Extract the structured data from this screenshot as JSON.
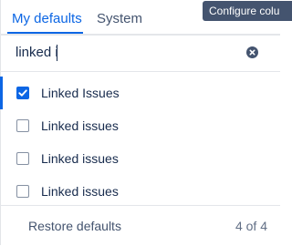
{
  "tabs": [
    {
      "label": "My defaults",
      "active": true
    },
    {
      "label": "System",
      "active": false
    }
  ],
  "tooltip": {
    "text": "Configure colu"
  },
  "search": {
    "value": "linked i",
    "placeholder": ""
  },
  "items": [
    {
      "label": "Linked Issues",
      "checked": true
    },
    {
      "label": "Linked issues",
      "checked": false
    },
    {
      "label": "Linked issues",
      "checked": false
    },
    {
      "label": "Linked issues",
      "checked": false
    }
  ],
  "footer": {
    "restore_label": "Restore defaults",
    "count": "4 of 4"
  },
  "colors": {
    "accent": "#0c66e4",
    "text": "#172b4d",
    "muted": "#44546f",
    "border": "#e4e6ea"
  }
}
